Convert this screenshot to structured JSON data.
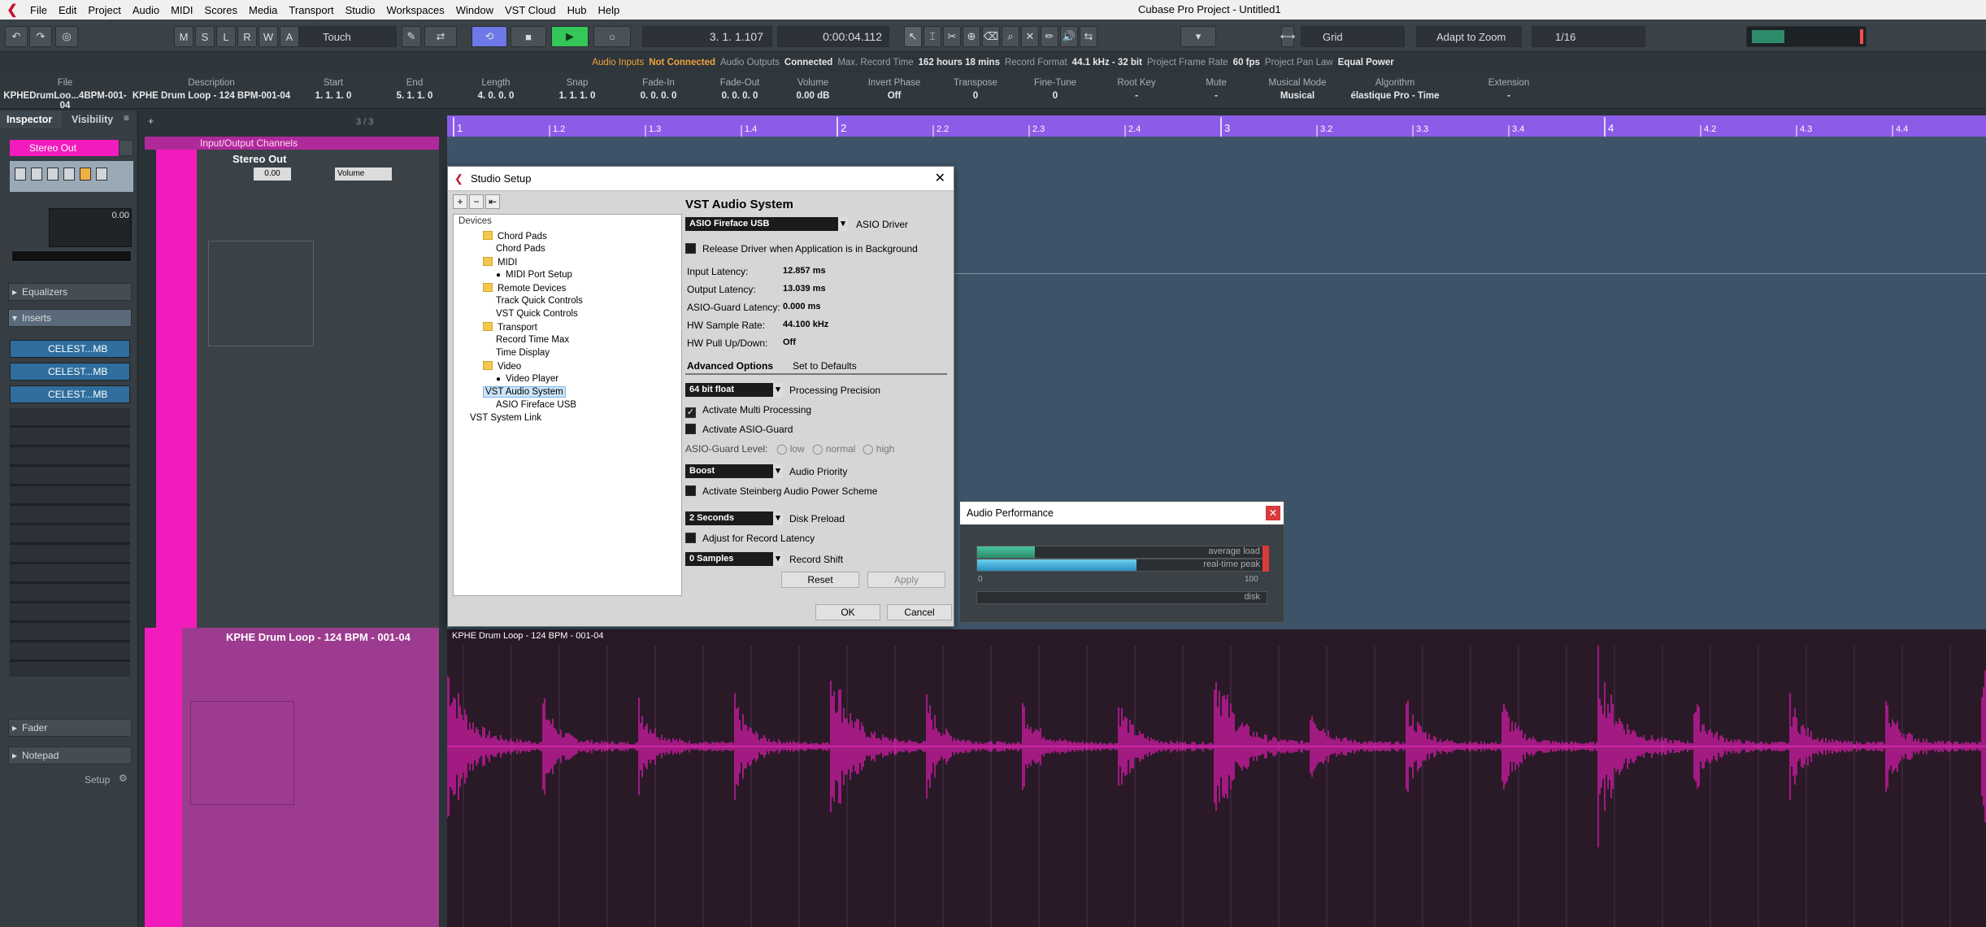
{
  "app": {
    "title": "Cubase Pro Project - Untitled1",
    "menus": [
      "File",
      "Edit",
      "Project",
      "Audio",
      "MIDI",
      "Scores",
      "Media",
      "Transport",
      "Studio",
      "Workspaces",
      "Window",
      "VST Cloud",
      "Hub",
      "Help"
    ]
  },
  "toolbar": {
    "msrwa": [
      "M",
      "S",
      "L",
      "R",
      "W",
      "A"
    ],
    "automation_mode": "Touch",
    "position_bars": "3. 1. 1.107",
    "position_time": "0:00:04.112",
    "snap_type": "Grid",
    "snap_mode": "Adapt to Zoom",
    "quantize": "1/16"
  },
  "statusline": {
    "audio_inputs_label": "Audio Inputs",
    "audio_inputs_value": "Not Connected",
    "audio_outputs_label": "Audio Outputs",
    "audio_outputs_value": "Connected",
    "max_record_label": "Max. Record Time",
    "max_record_value": "162 hours 18 mins",
    "record_format_label": "Record Format",
    "record_format_value": "44.1 kHz - 32 bit",
    "frame_rate_label": "Project Frame Rate",
    "frame_rate_value": "60 fps",
    "pan_law_label": "Project Pan Law",
    "pan_law_value": "Equal Power"
  },
  "infoline": [
    {
      "h": "File",
      "v": "KPHEDrumLoo...4BPM-001-04"
    },
    {
      "h": "Description",
      "v": "KPHE Drum Loop - 124 BPM-001-04"
    },
    {
      "h": "Start",
      "v": "1. 1. 1.   0"
    },
    {
      "h": "End",
      "v": "5. 1. 1.   0"
    },
    {
      "h": "Length",
      "v": "4. 0. 0.   0"
    },
    {
      "h": "Snap",
      "v": "1. 1. 1.   0"
    },
    {
      "h": "Fade-In",
      "v": "0. 0. 0.   0"
    },
    {
      "h": "Fade-Out",
      "v": "0. 0. 0.   0"
    },
    {
      "h": "Volume",
      "v": "0.00     dB"
    },
    {
      "h": "Invert Phase",
      "v": "Off"
    },
    {
      "h": "Transpose",
      "v": "0"
    },
    {
      "h": "Fine-Tune",
      "v": "0"
    },
    {
      "h": "Root Key",
      "v": "-"
    },
    {
      "h": "Mute",
      "v": "-"
    },
    {
      "h": "Musical Mode",
      "v": "Musical"
    },
    {
      "h": "Algorithm",
      "v": "élastique Pro - Time"
    },
    {
      "h": "Extension",
      "v": "-"
    }
  ],
  "inspector": {
    "tabs": [
      "Inspector",
      "Visibility"
    ],
    "channel_name": "Stereo Out",
    "fader_value": "0.00",
    "sections": {
      "equalizers": "Equalizers",
      "inserts": "Inserts",
      "fader": "Fader",
      "notepad": "Notepad"
    },
    "inserts": [
      "CELEST...MB",
      "CELEST...MB",
      "CELEST...MB"
    ],
    "setup_label": "Setup"
  },
  "tracks": {
    "counter": "3 / 3",
    "folder_name": "Input/Output Channels",
    "stereo_out": {
      "name": "Stereo Out",
      "volume": "0.00",
      "automation": "Volume"
    },
    "audio_track": {
      "name": "KPHE Drum Loop - 124 BPM - 001-04"
    }
  },
  "ruler": {
    "labels": [
      "1",
      "1.2",
      "1.3",
      "1.4",
      "2",
      "2.2",
      "2.3",
      "2.4",
      "3",
      "3.2",
      "3.3",
      "3.4",
      "4",
      "4.2",
      "4.3",
      "4.4"
    ]
  },
  "event": {
    "name": "KPHE Drum Loop - 124 BPM - 001-04"
  },
  "studio_setup": {
    "title": "Studio Setup",
    "devices_label": "Devices",
    "tree": [
      {
        "label": "Chord Pads",
        "type": "folder",
        "level": 1
      },
      {
        "label": "Chord Pads",
        "type": "item",
        "level": 2
      },
      {
        "label": "MIDI",
        "type": "folder",
        "level": 1
      },
      {
        "label": "MIDI Port Setup",
        "type": "item-icon",
        "level": 2
      },
      {
        "label": "Remote Devices",
        "type": "folder",
        "level": 1
      },
      {
        "label": "Track Quick Controls",
        "type": "item",
        "level": 2
      },
      {
        "label": "VST Quick Controls",
        "type": "item",
        "level": 2
      },
      {
        "label": "Transport",
        "type": "folder",
        "level": 1
      },
      {
        "label": "Record Time Max",
        "type": "item",
        "level": 2
      },
      {
        "label": "Time Display",
        "type": "item",
        "level": 2
      },
      {
        "label": "Video",
        "type": "folder",
        "level": 1
      },
      {
        "label": "Video Player",
        "type": "item-icon",
        "level": 2
      },
      {
        "label": "VST Audio System",
        "type": "selected",
        "level": 1
      },
      {
        "label": "ASIO Fireface USB",
        "type": "item",
        "level": 2
      },
      {
        "label": "VST System Link",
        "type": "item",
        "level": 0
      }
    ],
    "heading": "VST Audio System",
    "asio_driver_value": "ASIO Fireface USB",
    "asio_driver_label": "ASIO Driver",
    "release_driver": "Release Driver when Application is in Background",
    "latency": [
      {
        "label": "Input Latency:",
        "value": "12.857 ms"
      },
      {
        "label": "Output Latency:",
        "value": "13.039 ms"
      },
      {
        "label": "ASIO-Guard Latency:",
        "value": "0.000 ms"
      },
      {
        "label": "HW Sample Rate:",
        "value": "44.100 kHz"
      },
      {
        "label": "HW Pull Up/Down:",
        "value": "Off"
      }
    ],
    "advanced_options": "Advanced Options",
    "set_to_defaults": "Set to Defaults",
    "precision_value": "64 bit float",
    "precision_label": "Processing Precision",
    "multi_processing": "Activate Multi Processing",
    "asio_guard": "Activate ASIO-Guard",
    "asio_guard_level": "ASIO-Guard Level:",
    "asio_levels": [
      "low",
      "normal",
      "high"
    ],
    "priority_value": "Boost",
    "priority_label": "Audio Priority",
    "power_scheme": "Activate Steinberg Audio Power Scheme",
    "preload_value": "2 Seconds",
    "preload_label": "Disk Preload",
    "adjust_latency": "Adjust for Record Latency",
    "shift_value": "0 Samples",
    "shift_label": "Record Shift",
    "reset": "Reset",
    "apply": "Apply",
    "ok": "OK",
    "cancel": "Cancel"
  },
  "audio_performance": {
    "title": "Audio Performance",
    "average_label": "average load",
    "average_value": 0.2,
    "peak_label": "real-time peak",
    "peak_value": 0.55,
    "scale_min": "0",
    "scale_max": "100",
    "disk_label": "disk"
  }
}
